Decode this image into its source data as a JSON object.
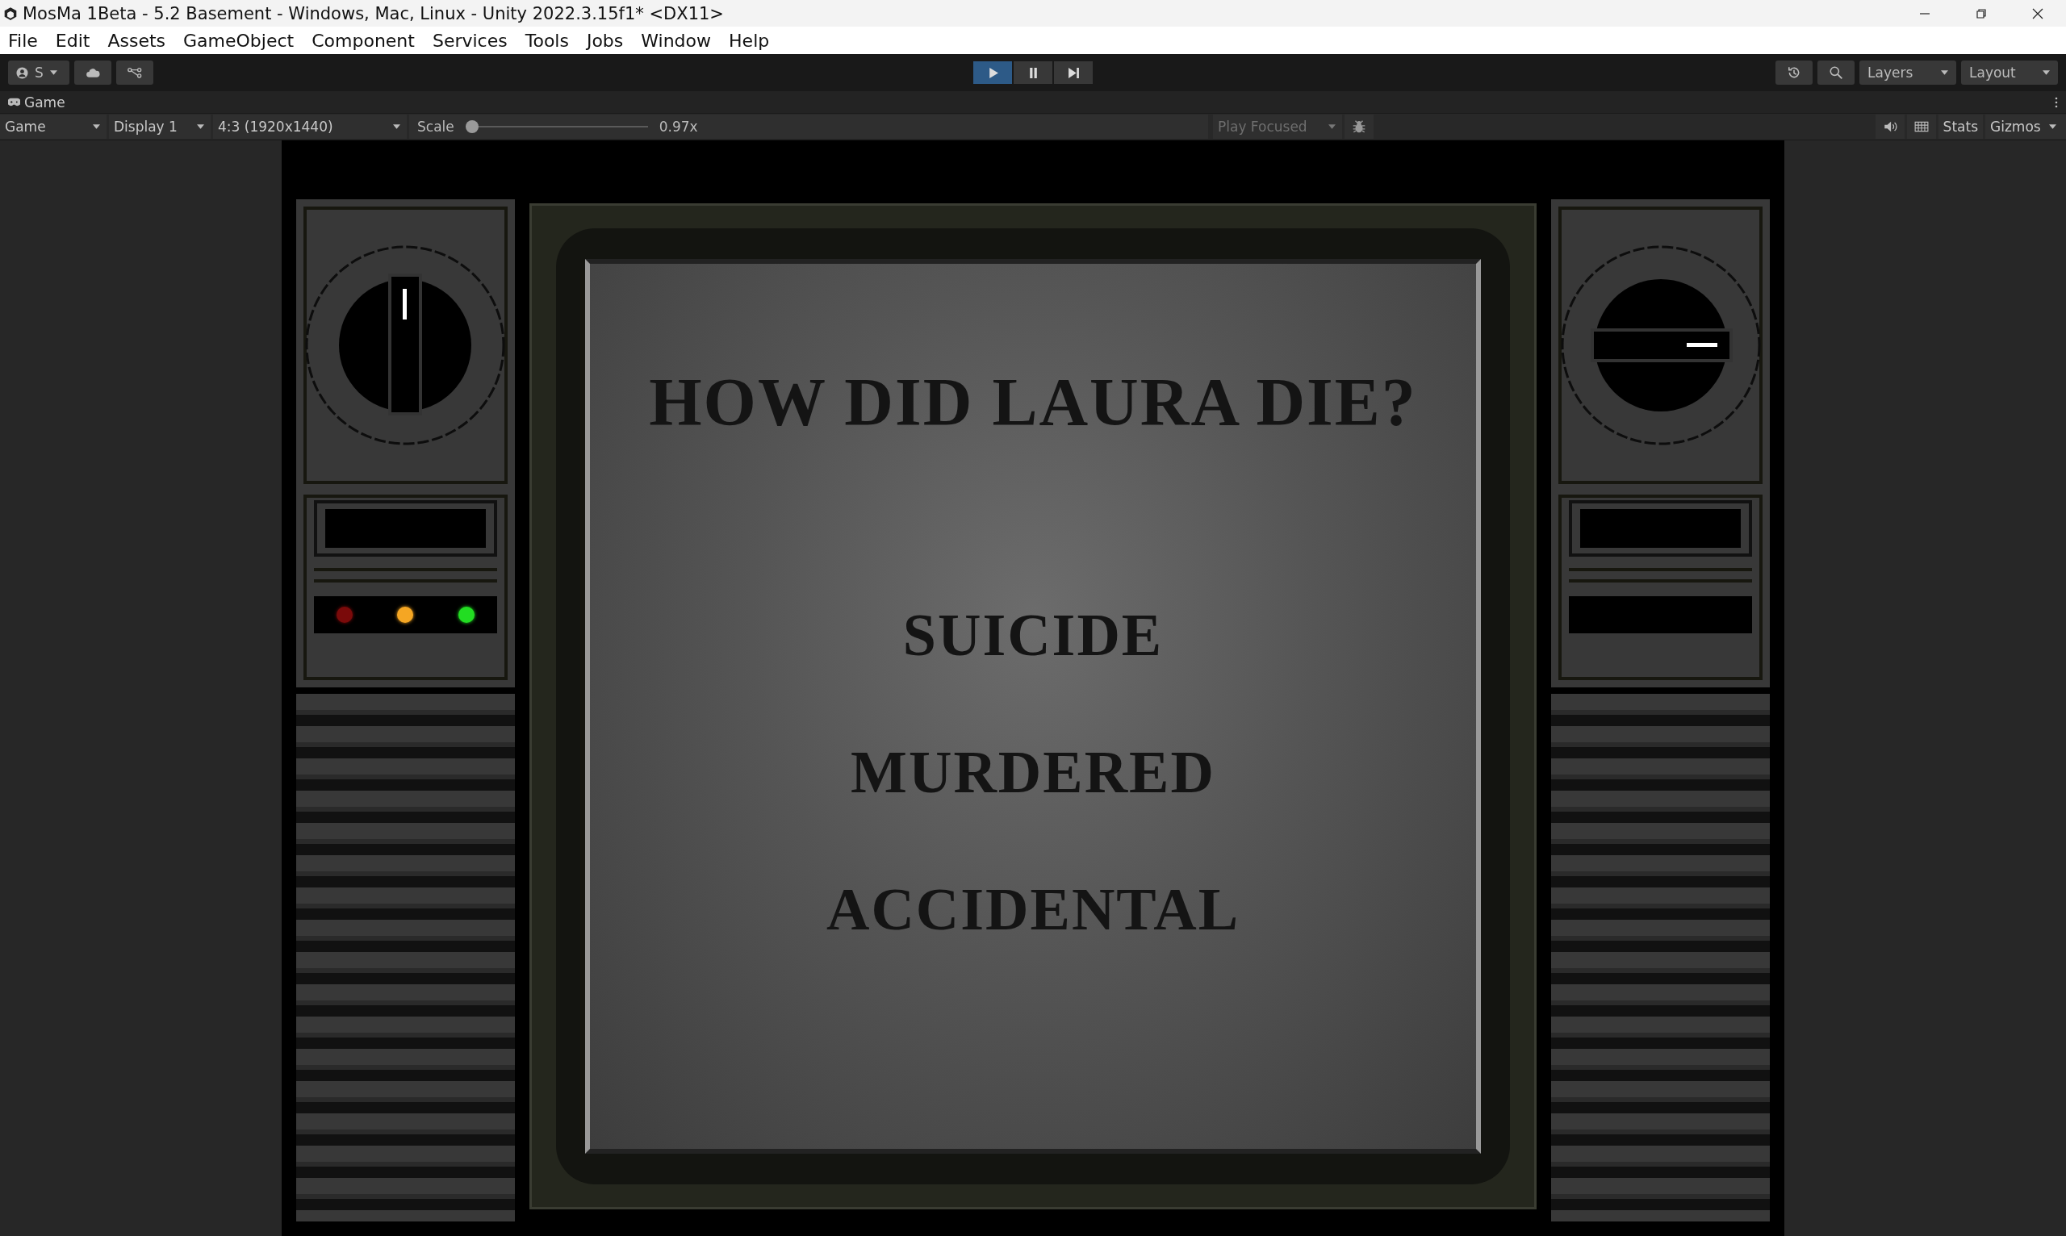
{
  "window": {
    "title": "MosMa 1Beta - 5.2 Basement - Windows, Mac, Linux - Unity 2022.3.15f1* <DX11>"
  },
  "menu": [
    "File",
    "Edit",
    "Assets",
    "GameObject",
    "Component",
    "Services",
    "Tools",
    "Jobs",
    "Window",
    "Help"
  ],
  "toolbar": {
    "account": "S",
    "play_controls": [
      {
        "kind": "play",
        "on": true
      },
      {
        "kind": "pause",
        "on": false
      },
      {
        "kind": "step",
        "on": false
      }
    ],
    "layers": "Layers",
    "layout": "Layout"
  },
  "game_tab": {
    "label": "Game"
  },
  "game_toolbar": {
    "view": "Game",
    "display": "Display 1",
    "aspect": "4:3 (1920x1440)",
    "scale_label": "Scale",
    "scale": {
      "level": 0
    },
    "scale_reading": "0.97x",
    "play_focused": "Play Focused",
    "stats": "Stats",
    "gizmos": "Gizmos"
  },
  "game": {
    "question": "HOW DID LAURA DIE?",
    "answers": [
      "SUICIDE",
      "MURDERED",
      "ACCIDENTAL"
    ],
    "left_panel": {
      "knob_turned": false,
      "lights": [
        {
          "color": "#7a0a0a"
        },
        {
          "color": "#f5a623"
        },
        {
          "color": "#22dd22"
        }
      ]
    },
    "right_panel": {
      "knob_turned": true
    }
  }
}
